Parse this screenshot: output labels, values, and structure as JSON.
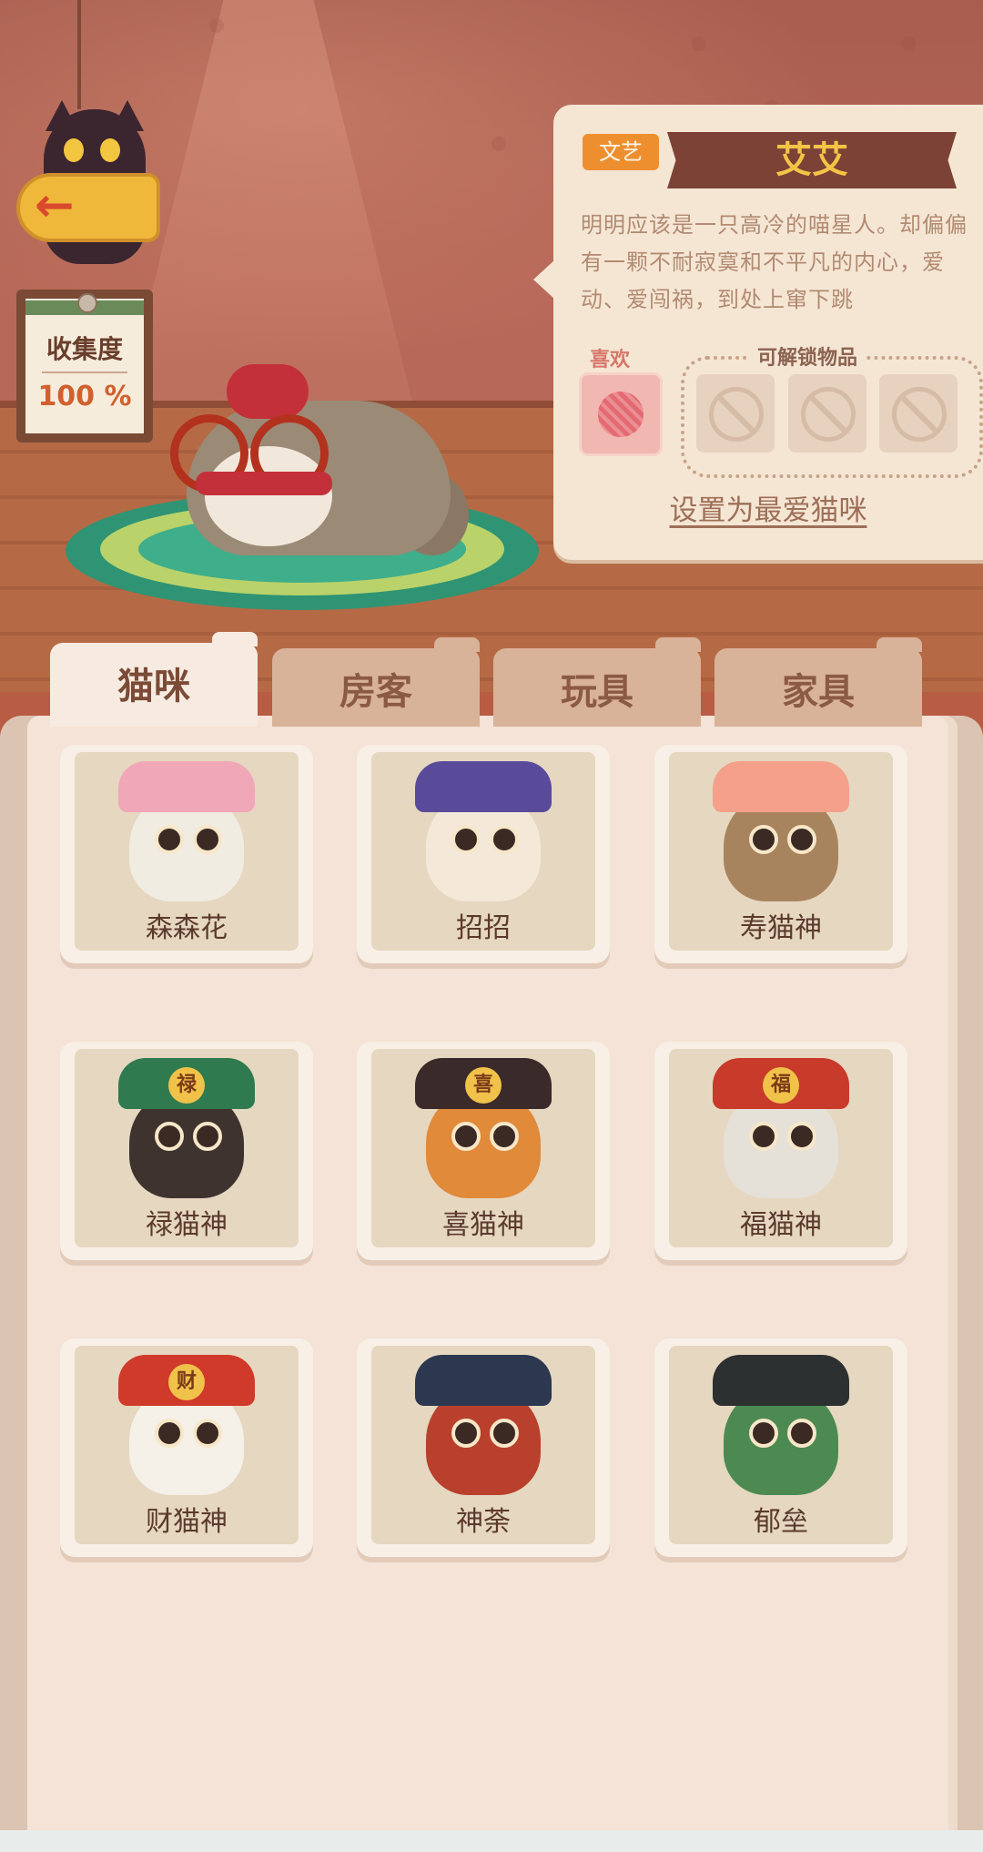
{
  "collection": {
    "title": "收集度",
    "value": "100 %"
  },
  "pet_info": {
    "tag": "文艺",
    "name": "艾艾",
    "description": "明明应该是一只高冷的喵星人。却偏偏有一颗不耐寂寞和不平凡的内心，爱动、爱闯祸，到处上窜下跳",
    "likes_label": "喜欢",
    "likes_item_icon": "yarn-ball-icon",
    "unlock_label": "可解锁物品",
    "unlock_slots": [
      "locked-icon",
      "locked-icon",
      "locked-icon"
    ],
    "set_favorite_label": "设置为最爱猫咪"
  },
  "tabs": [
    {
      "label": "猫咪",
      "active": true
    },
    {
      "label": "房客",
      "active": false
    },
    {
      "label": "玩具",
      "active": false
    },
    {
      "label": "家具",
      "active": false
    }
  ],
  "cats": [
    {
      "name": "森森花",
      "color": "#f1ece2",
      "accent": "#f0a7b8"
    },
    {
      "name": "招招",
      "color": "#f4e9d9",
      "accent": "#5a4a9a"
    },
    {
      "name": "寿猫神",
      "color": "#a8845e",
      "accent": "#f4a08a"
    },
    {
      "name": "禄猫神",
      "color": "#3f3330",
      "accent": "#2f7a4f",
      "badge": "禄"
    },
    {
      "name": "喜猫神",
      "color": "#e08a3a",
      "accent": "#3a2a2a",
      "badge": "喜"
    },
    {
      "name": "福猫神",
      "color": "#e5e0d8",
      "accent": "#c83a2a",
      "badge": "福"
    },
    {
      "name": "财猫神",
      "color": "#f5f0e8",
      "accent": "#d03a2a",
      "badge": "财"
    },
    {
      "name": "神荼",
      "color": "#b8402c",
      "accent": "#2c3850"
    },
    {
      "name": "郁垒",
      "color": "#4c8a52",
      "accent": "#2c3030"
    }
  ],
  "colors": {
    "accent_tag": "#ee8f2f",
    "name_ribbon": "#7c4236",
    "name_text": "#f3c446",
    "active_tab": "#f7ebe1",
    "inactive_tab": "#d9b29a"
  }
}
